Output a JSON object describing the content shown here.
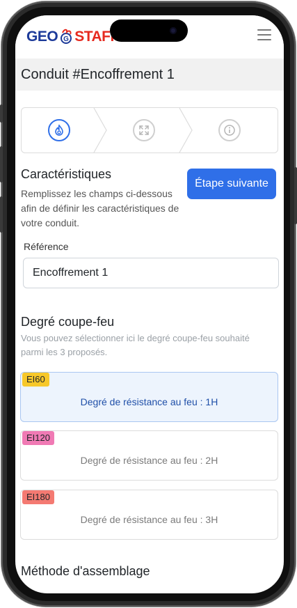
{
  "header": {
    "logo_geo": "GEO",
    "logo_staff": "STAFF"
  },
  "page": {
    "title": "Conduit #Encoffrement 1"
  },
  "stepper": {
    "steps": [
      {
        "icon": "fire-icon",
        "state": "active"
      },
      {
        "icon": "expand-icon",
        "state": "inactive"
      },
      {
        "icon": "info-icon",
        "state": "inactive"
      }
    ]
  },
  "characteristics": {
    "title": "Caractéristiques",
    "description": "Remplissez les champs ci-dessous afin de définir les caractéristiques de votre conduit.",
    "next_button": "Étape suivante",
    "reference_label": "Référence",
    "reference_value": "Encoffrement 1"
  },
  "fire_rating": {
    "title": "Degré coupe-feu",
    "description": "Vous pouvez sélectionner ici le degré coupe-feu souhaité parmi les 3 proposés.",
    "options": [
      {
        "badge": "EI60",
        "label": "Degré de résistance au feu : 1H",
        "selected": true,
        "badge_color": "#f7c82a"
      },
      {
        "badge": "EI120",
        "label": "Degré de résistance au feu : 2H",
        "selected": false,
        "badge_color": "#f07ab4"
      },
      {
        "badge": "EI180",
        "label": "Degré de résistance au feu : 3H",
        "selected": false,
        "badge_color": "#f47a72"
      }
    ]
  },
  "assembly": {
    "title": "Méthode d'assemblage"
  },
  "colors": {
    "accent": "#2f6fe8",
    "logo_blue": "#1c3a99",
    "logo_red": "#e62a1f"
  }
}
